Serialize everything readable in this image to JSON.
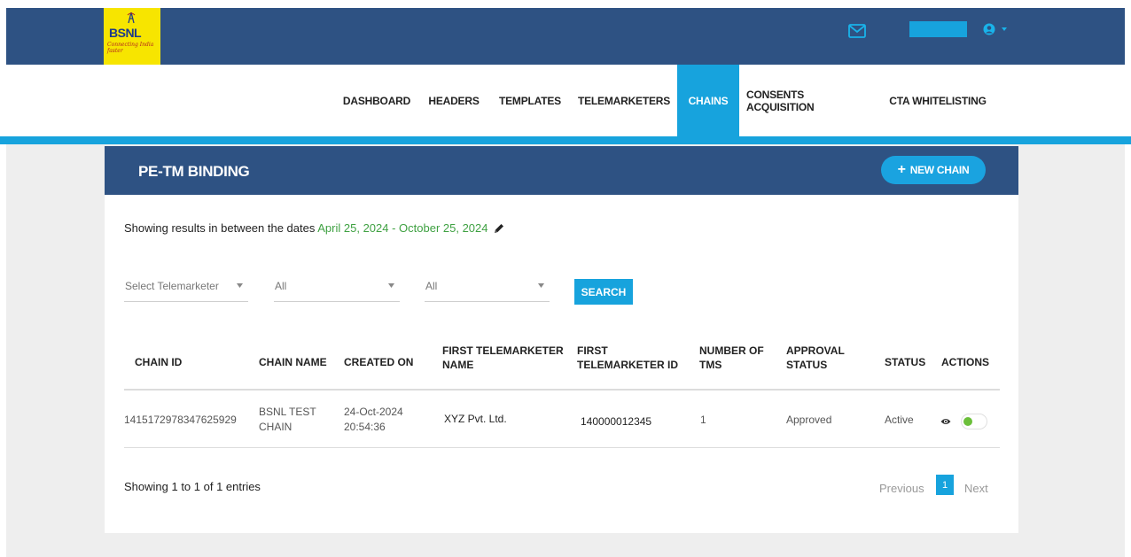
{
  "header": {
    "logo_text": "BSNL",
    "logo_tagline": "Connecting India faster",
    "icons": [
      "mail-icon",
      "user-icon",
      "caret-down-icon"
    ]
  },
  "nav": {
    "items": [
      {
        "label": "DASHBOARD"
      },
      {
        "label": "HEADERS"
      },
      {
        "label": "TEMPLATES"
      },
      {
        "label": "TELEMARKETERS"
      },
      {
        "label": "CHAINS"
      },
      {
        "label": "CONSENTS ACQUISITION"
      },
      {
        "label": "CTA WHITELISTING"
      }
    ],
    "active": "CHAINS"
  },
  "page": {
    "title": "PE-TM BINDING",
    "new_button": "NEW CHAIN",
    "date_prefix": "Showing results in between the dates",
    "date_range": "April 25, 2024 - October 25, 2024"
  },
  "filters": {
    "telemarketer": "Select Telemarketer",
    "filter2": "All",
    "filter3": "All",
    "search_label": "SEARCH"
  },
  "table": {
    "headers": {
      "chain_id": "CHAIN ID",
      "chain_name": "CHAIN NAME",
      "created_on": "CREATED ON",
      "first_tm_name_1": "FIRST TELEMARKETER",
      "first_tm_name_2": "NAME",
      "first_tm_id_1": "FIRST",
      "first_tm_id_2": "TELEMARKETER ID",
      "num_tms_1": "NUMBER OF",
      "num_tms_2": "TMS",
      "approval_1": "APPROVAL",
      "approval_2": "STATUS",
      "status": "STATUS",
      "actions": "ACTIONS"
    },
    "rows": [
      {
        "chain_id": "14151729783476259​29",
        "chain_name_1": "BSNL TEST",
        "chain_name_2": "CHAIN",
        "created_date": "24-Oct-2024",
        "created_time": "20:54:36",
        "first_tm_name": "XYZ  Pvt. Ltd.",
        "first_tm_id": "140000012345",
        "num_tms": "1",
        "approval": "Approved",
        "status": "Active",
        "enabled": true
      }
    ]
  },
  "footer": {
    "entries": "Showing 1 to 1 of 1 entries",
    "previous": "Previous",
    "current_page": "1",
    "next": "Next"
  },
  "colors": {
    "header_bg": "#2e5283",
    "accent": "#17a3dd",
    "logo_bg": "#f7e500",
    "date_green": "#3fa142",
    "toggle_on": "#6bbf3a"
  }
}
